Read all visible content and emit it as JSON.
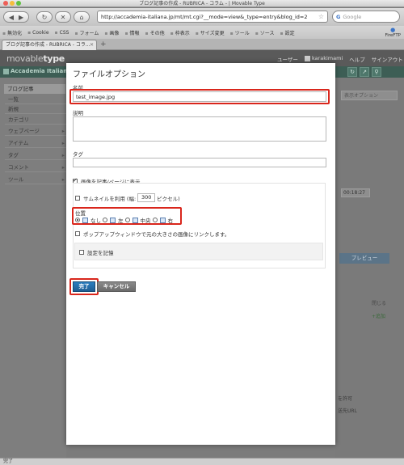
{
  "browser": {
    "window_title": "ブログ記事の作成 - RUBRICA - コラム - | Movable Type",
    "url": "http://accademia-italiana.jp/mt/mt.cgi?__mode=view&_type=entry&blog_id=2",
    "search_placeholder": "Google",
    "bookmarks": [
      "無効化",
      "Cookie",
      "CSS",
      "フォーム",
      "画像",
      "情報",
      "その他",
      "枠表示",
      "サイズ変更",
      "ツール",
      "ソース",
      "設定"
    ],
    "firefox_label": "FireFTP",
    "tab_title": "ブログ記事の作成 - RUBRICA - コラ...",
    "status": "完了"
  },
  "mt": {
    "logo_prefix": "movable",
    "logo_suffix": "type",
    "user_label": "ユーザー",
    "username": "karakimami",
    "help": "ヘルプ",
    "signout": "サインアウト",
    "blog_name": "Accademia Italian",
    "sidebar": {
      "header": "ブログ記事",
      "items": [
        "一覧",
        "新規",
        "カテゴリ",
        "ウェブページ",
        "アイテム",
        "タグ",
        "コメント",
        "ツール"
      ]
    },
    "display_option": "表示オプション",
    "time_value": "00:18:27",
    "preview": "プレビュー",
    "close_link": "閉じる",
    "add_link": "追加",
    "allow_text": "を許可",
    "url_text": "送先URL"
  },
  "dialog": {
    "title": "ファイルオプション",
    "name_label": "名前",
    "name_value": "test_image.jpg",
    "description_label": "説明",
    "tag_label": "タグ",
    "show_image_label": "画像を記事/ページに表示",
    "thumbnail_label": "サムネイルを利用 (幅:",
    "thumbnail_width": "300",
    "thumbnail_unit": "ピクセル)",
    "position_label": "位置",
    "positions": [
      "なし",
      "左",
      "中央",
      "右"
    ],
    "popup_label": "ポップアップウィンドウで元の大きさの画像にリンクします。",
    "remember_label": "設定を記憶",
    "ok_button": "完了",
    "cancel_button": "キャンセル"
  },
  "colors": {
    "highlight": "#d9261c",
    "ok_button": "#1f5d93"
  }
}
